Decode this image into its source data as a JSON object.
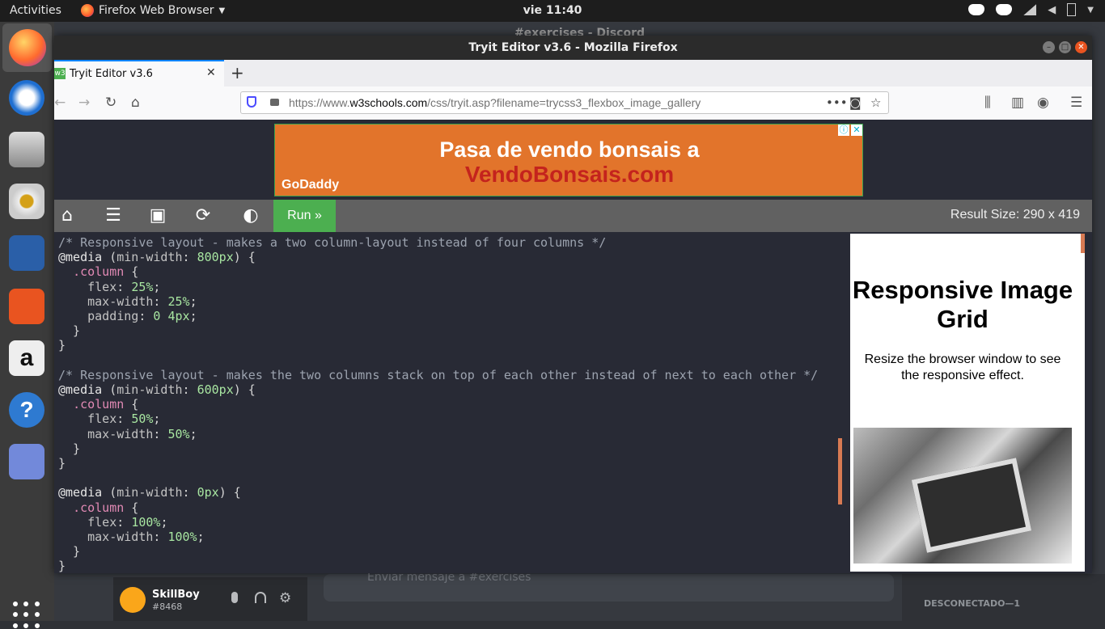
{
  "topbar": {
    "activities": "Activities",
    "app_menu": "Firefox Web Browser",
    "clock": "vie 11:40"
  },
  "background_window": {
    "title": "#exercises - Discord",
    "user_name": "SkillBoy",
    "user_tag": "#8468",
    "message_placeholder": "Enviar mensaje a #exercises",
    "members_header": "DESCONECTADO—1"
  },
  "firefox": {
    "window_title": "Tryit Editor v3.6 - Mozilla Firefox",
    "tab_title": "Tryit Editor v3.6",
    "tab_favicon": "w3",
    "url_prefix": "https://www.",
    "url_domain": "w3schools.com",
    "url_path": "/css/tryit.asp?filename=trycss3_flexbox_image_gallery"
  },
  "ad": {
    "line1": "Pasa de vendo bonsais a",
    "line2": "VendoBonsais.com",
    "brand": "GoDaddy"
  },
  "tryit": {
    "run_label": "Run »",
    "result_size": "Result Size: 290 x 419"
  },
  "result": {
    "title": "Responsive Image Grid",
    "description": "Resize the browser window to see the responsive effect."
  },
  "colors": {
    "run_button": "#4caf50",
    "editor_bg": "#282a35",
    "toolbar_bg": "#616161",
    "ad_bg": "#e2742b"
  }
}
